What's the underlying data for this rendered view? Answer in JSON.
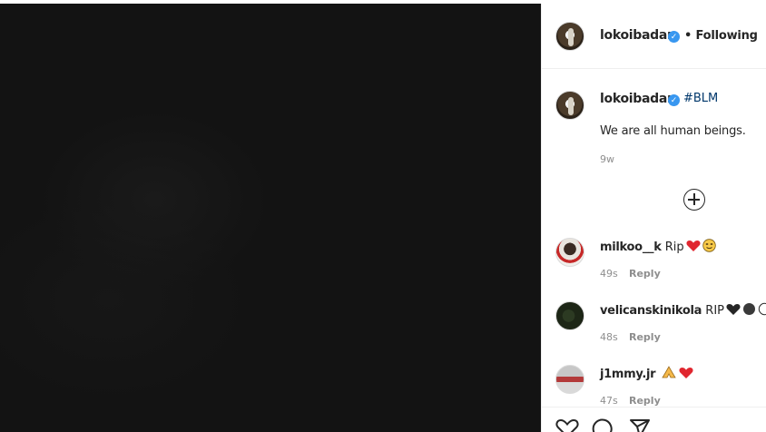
{
  "post": {
    "owner": "lokoibadan",
    "follow_status": "Following",
    "separator": "•",
    "caption_hashtag": "#BLM",
    "caption_text": "We are all human beings.",
    "caption_age": "9w"
  },
  "comments": [
    {
      "user": "milkoo__k",
      "text": "Rip",
      "emojis": [
        "heart-red-icon",
        "grinning-face-icon"
      ],
      "age": "49s",
      "reply_label": "Reply"
    },
    {
      "user": "velicanskinikola",
      "text": "RIP",
      "emojis": [
        "heart-black-icon",
        "circle-black-icon",
        "circle-white-icon"
      ],
      "age": "48s",
      "reply_label": "Reply"
    },
    {
      "user": "j1mmy.jr",
      "text": "",
      "emojis": [
        "folded-hands-icon",
        "heart-red-icon"
      ],
      "age": "47s",
      "reply_label": "Reply"
    }
  ],
  "colors": {
    "verified": "#3897f0",
    "link": "#00376b",
    "muted": "#8e8e8e",
    "media_bg": "#131313"
  }
}
